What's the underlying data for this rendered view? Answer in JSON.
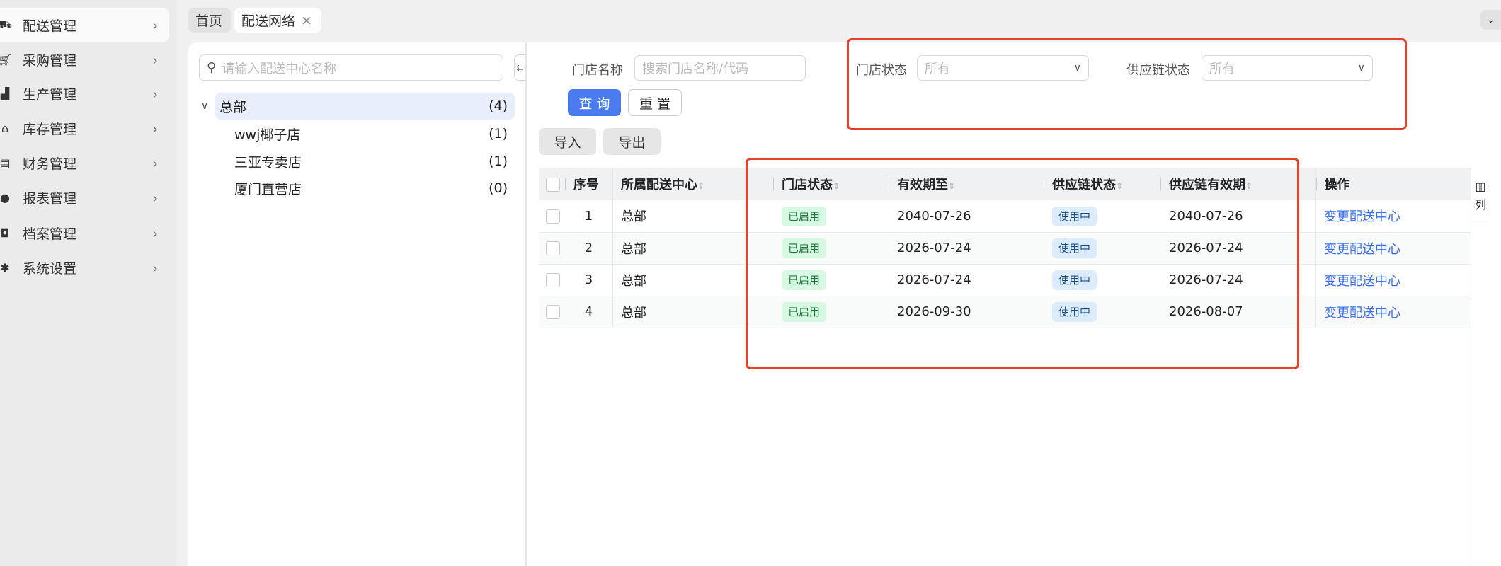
{
  "sidebar": {
    "items": [
      {
        "label": "配送管理",
        "icon": "truck-icon",
        "active": true
      },
      {
        "label": "采购管理",
        "icon": "cart-icon"
      },
      {
        "label": "生产管理",
        "icon": "factory-icon"
      },
      {
        "label": "库存管理",
        "icon": "warehouse-icon"
      },
      {
        "label": "财务管理",
        "icon": "finance-icon"
      },
      {
        "label": "报表管理",
        "icon": "globe-icon"
      },
      {
        "label": "档案管理",
        "icon": "inbox-icon"
      },
      {
        "label": "系统设置",
        "icon": "gear-icon"
      }
    ]
  },
  "tabs": [
    {
      "label": "首页"
    },
    {
      "label": "配送网络",
      "close": "×"
    }
  ],
  "tree": {
    "search_placeholder": "请输入配送中心名称",
    "nodes": [
      {
        "label": "总部",
        "count": "(4)"
      },
      {
        "label": "wwj椰子店",
        "count": "(1)"
      },
      {
        "label": "三亚专卖店",
        "count": "(1)"
      },
      {
        "label": "厦门直营店",
        "count": "(0)"
      }
    ]
  },
  "filters": {
    "store_name_label": "门店名称",
    "store_name_placeholder": "搜索门店名称/代码",
    "store_status_label": "门店状态",
    "store_status_value": "所有",
    "supply_status_label": "供应链状态",
    "supply_status_value": "所有",
    "query": "查 询",
    "reset": "重 置"
  },
  "toolbar": {
    "import": "导入",
    "export": "导出"
  },
  "table": {
    "headers": [
      "序号",
      "所属配送中心",
      "门店状态",
      "有效期至",
      "供应链状态",
      "供应链有效期",
      "操作"
    ],
    "column_settings": "列",
    "rows": [
      {
        "no": "1",
        "center": "总部",
        "status": "已启用",
        "valid": "2040-07-26",
        "supply": "使用中",
        "supply_valid": "2040-07-26",
        "action": "变更配送中心"
      },
      {
        "no": "2",
        "center": "总部",
        "status": "已启用",
        "valid": "2026-07-24",
        "supply": "使用中",
        "supply_valid": "2026-07-24",
        "action": "变更配送中心"
      },
      {
        "no": "3",
        "center": "总部",
        "status": "已启用",
        "valid": "2026-07-24",
        "supply": "使用中",
        "supply_valid": "2026-07-24",
        "action": "变更配送中心"
      },
      {
        "no": "4",
        "center": "总部",
        "status": "已启用",
        "valid": "2026-09-30",
        "supply": "使用中",
        "supply_valid": "2026-08-07",
        "action": "变更配送中心"
      }
    ]
  },
  "colors": {
    "accent": "#4a7bef",
    "highlight": "#e8412b"
  }
}
